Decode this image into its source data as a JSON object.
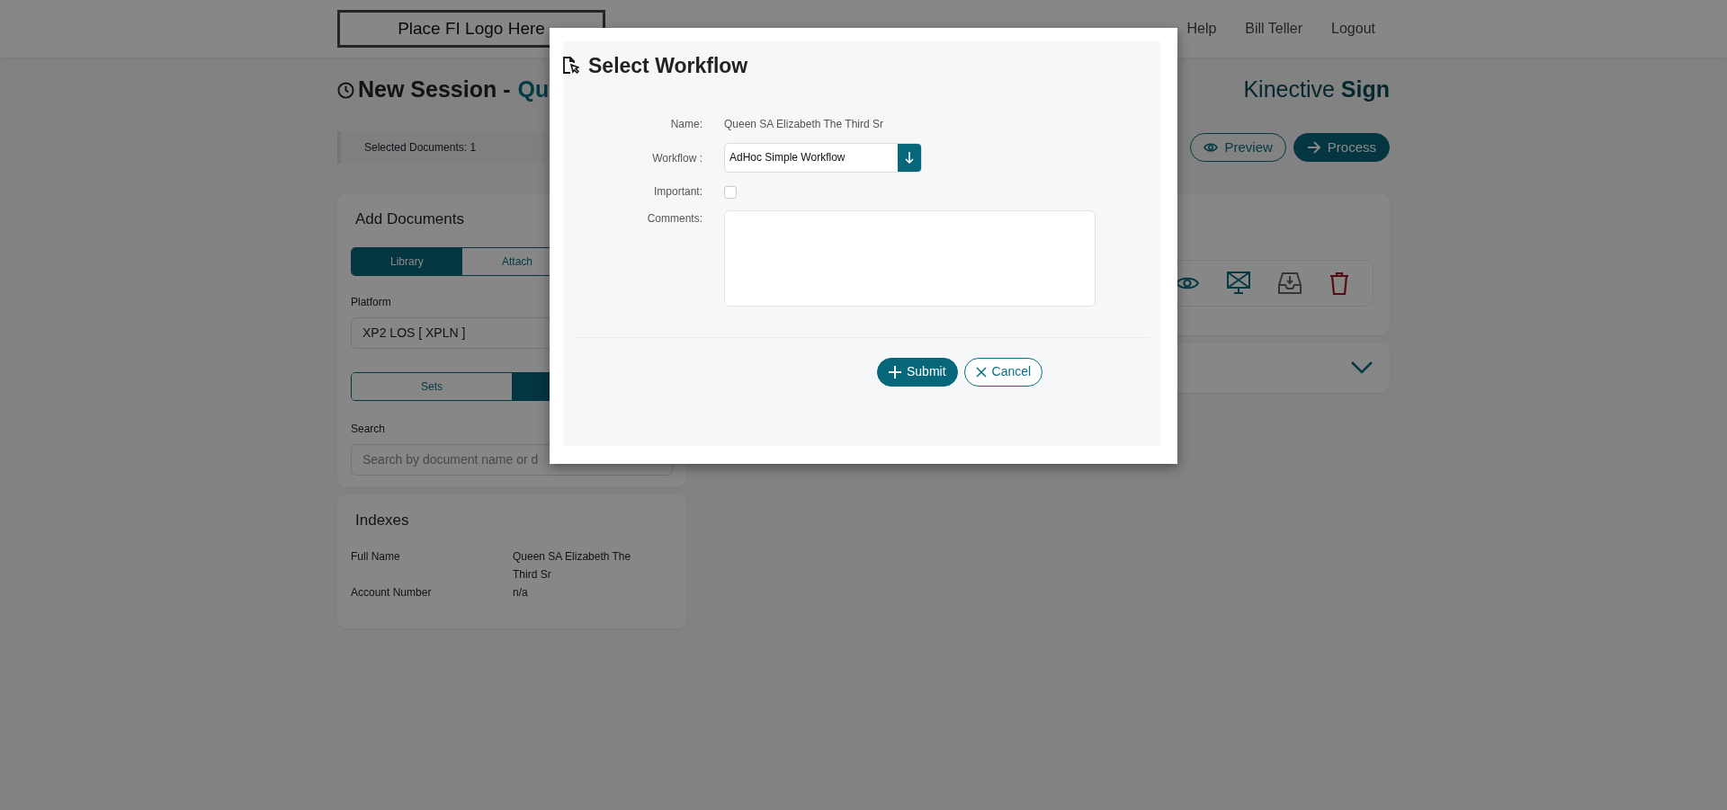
{
  "header": {
    "logo": "Place FI Logo Here",
    "nav": [
      {
        "label": "Help"
      },
      {
        "label": "Bill Teller"
      },
      {
        "label": "Logout"
      }
    ]
  },
  "page": {
    "title": "New Session -",
    "title_name": "Qu",
    "brand_light": "Kinective",
    "brand_bold": "Sign"
  },
  "toolbar": {
    "selected_documents": "Selected Documents: 1",
    "buttons": [
      {
        "label": "Preview",
        "kind": "outline"
      },
      {
        "label": "Process",
        "kind": "solid"
      }
    ]
  },
  "add_documents": {
    "title": "Add Documents",
    "tabs": [
      {
        "label": "Library",
        "selected": true
      },
      {
        "label": "Attach",
        "selected": false
      }
    ],
    "platform_label": "Platform",
    "platform_value": "XP2 LOS [ XPLN ]",
    "view_toggle": [
      {
        "label": "Sets",
        "selected": false
      },
      {
        "selected": true
      }
    ],
    "search_label": "Search",
    "search_placeholder": "Search by document name or d"
  },
  "indexes": {
    "title": "Indexes",
    "rows": [
      {
        "key": "Full Name",
        "value": "Queen SA Elizabeth The Third Sr"
      },
      {
        "key": "Account Number",
        "value": "n/a"
      }
    ]
  },
  "modal": {
    "title": "Select Workflow",
    "fields": [
      {
        "label": "Name:",
        "kind": "text",
        "value": "Queen SA Elizabeth The Third Sr"
      },
      {
        "label": "Workflow :",
        "kind": "select",
        "value": "AdHoc Simple Workflow"
      },
      {
        "label": "Important:",
        "kind": "checkbox",
        "checked": false
      },
      {
        "label": "Comments:",
        "kind": "textarea"
      }
    ],
    "buttons": [
      {
        "label": "Submit",
        "kind": "primary"
      },
      {
        "label": "Cancel",
        "kind": "secondary"
      }
    ]
  }
}
